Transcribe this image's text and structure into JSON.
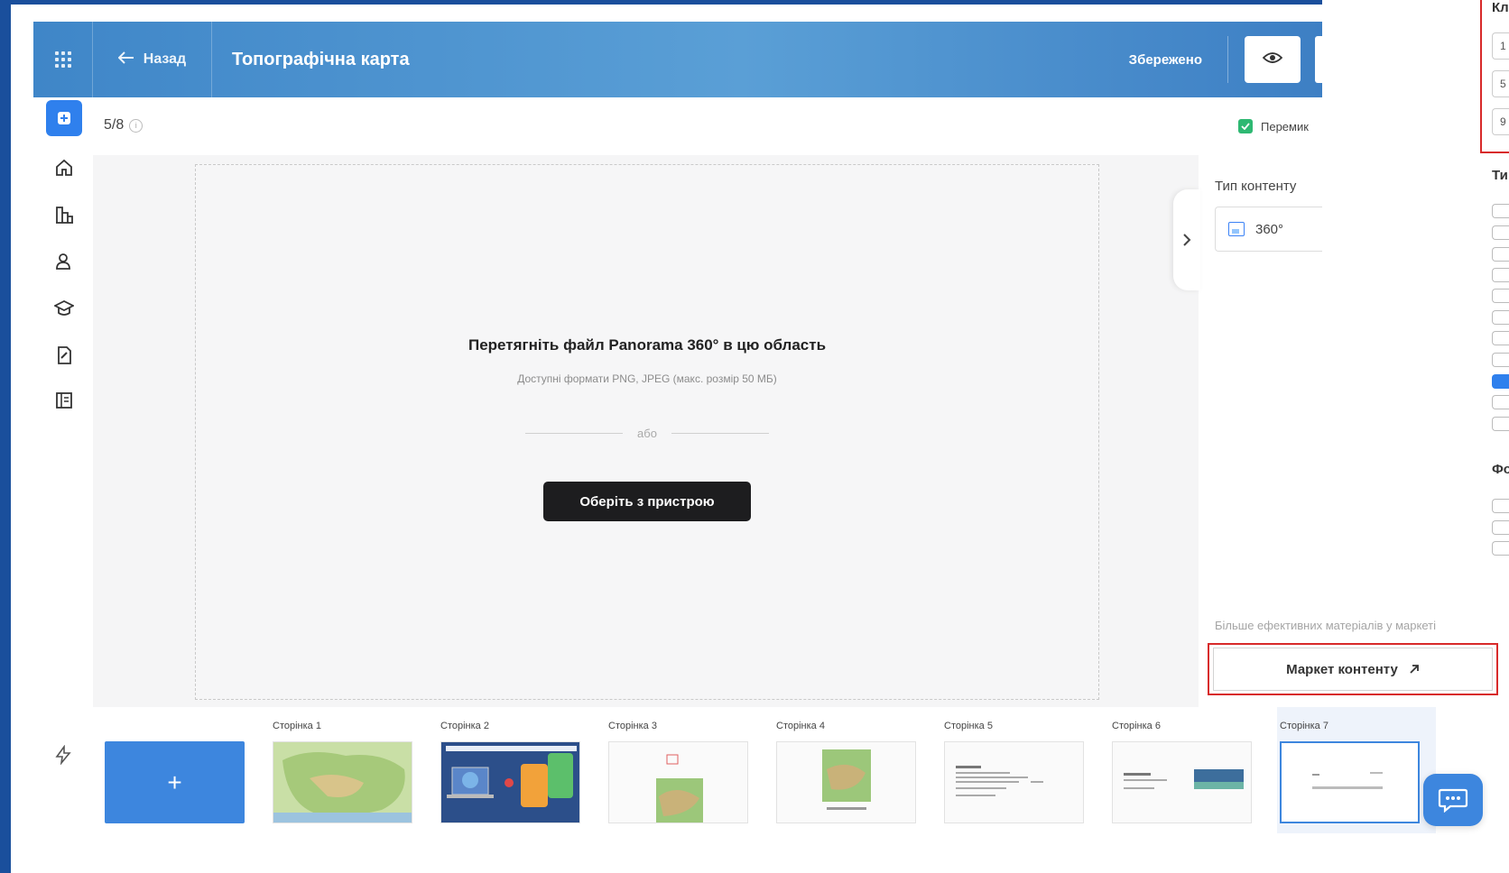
{
  "header": {
    "back_label": "Назад",
    "title": "Топографічна карта",
    "saved_label": "Збережено"
  },
  "toolbar": {
    "page_count": "5/8",
    "toggle_label": "Перемик"
  },
  "dropzone": {
    "title": "Перетягніть файл Panorama 360° в цю область",
    "subtitle": "Доступні формати PNG, JPEG (макс. розмір 50 МБ)",
    "or_label": "або",
    "button_label": "Оберіть з пристрою"
  },
  "settings": {
    "content_type_label": "Тип контенту",
    "content_type_value": "360°",
    "market_hint": "Більше ефективних матеріалів у маркеті",
    "market_button": "Маркет контенту"
  },
  "popup": {
    "heading": "Кл",
    "inputs": [
      "1",
      "5",
      "9"
    ],
    "section_1": "Ти",
    "section_2": "Фо",
    "checkbox_checked_index": 8
  },
  "pages": [
    {
      "label": "Сторінка 1"
    },
    {
      "label": "Сторінка 2"
    },
    {
      "label": "Сторінка 3"
    },
    {
      "label": "Сторінка 4"
    },
    {
      "label": "Сторінка 5"
    },
    {
      "label": "Сторінка 6"
    },
    {
      "label": "Сторінка 7"
    }
  ],
  "add_page_symbol": "+",
  "colors": {
    "brand_blue": "#3d86de",
    "highlight_red": "#d82a2a",
    "toggle_green": "#2eb872"
  }
}
